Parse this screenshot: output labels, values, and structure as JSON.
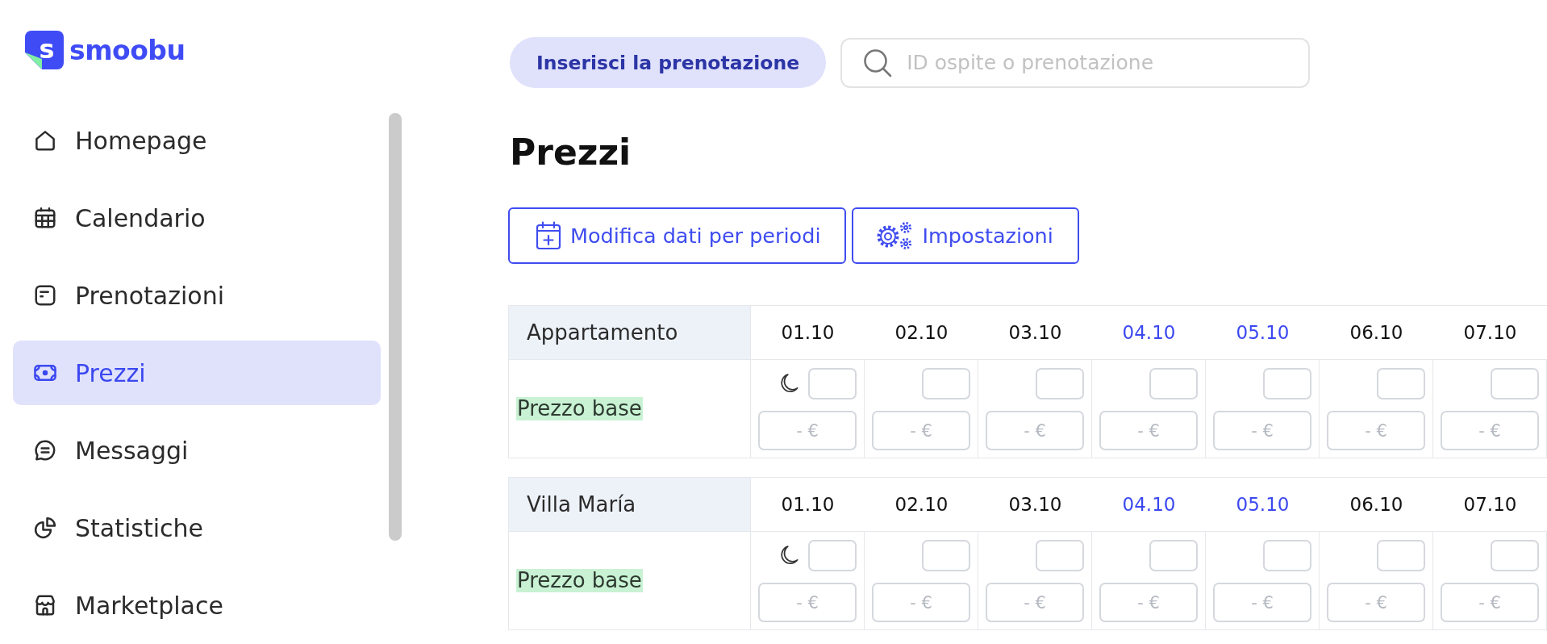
{
  "logo": {
    "mark": "s",
    "name": "smoobu"
  },
  "sidebar": {
    "items": [
      {
        "label": "Homepage",
        "selected": false
      },
      {
        "label": "Calendario",
        "selected": false
      },
      {
        "label": "Prenotazioni",
        "selected": false
      },
      {
        "label": "Prezzi",
        "selected": true
      },
      {
        "label": "Messaggi",
        "selected": false
      },
      {
        "label": "Statistiche",
        "selected": false
      },
      {
        "label": "Marketplace",
        "selected": false
      }
    ]
  },
  "topbar": {
    "add_button": "Inserisci la prenotazione",
    "search": {
      "placeholder": "ID ospite o prenotazione"
    }
  },
  "title": "Prezzi",
  "actions": [
    {
      "label": "Modifica dati per periodi"
    },
    {
      "label": "Impostazioni"
    }
  ],
  "properties": [
    {
      "name": "Appartamento",
      "days": [
        {
          "date": "01.10",
          "highlighted": false
        },
        {
          "date": "02.10",
          "highlighted": false
        },
        {
          "date": "03.10",
          "highlighted": false
        },
        {
          "date": "04.10",
          "highlighted": true
        },
        {
          "date": "05.10",
          "highlighted": true
        },
        {
          "date": "06.10",
          "highlighted": false
        },
        {
          "date": "07.10",
          "highlighted": false
        }
      ],
      "rows": [
        {
          "label": "Prezzo base",
          "cells": [
            {
              "marked": true,
              "placeholder": "- €"
            },
            {
              "marked": false,
              "placeholder": "- €"
            },
            {
              "marked": false,
              "placeholder": "- €"
            },
            {
              "marked": false,
              "placeholder": "- €"
            },
            {
              "marked": false,
              "placeholder": "- €"
            },
            {
              "marked": false,
              "placeholder": "- €"
            },
            {
              "marked": false,
              "placeholder": "- €"
            }
          ]
        }
      ]
    },
    {
      "name": "Villa María",
      "days": [
        {
          "date": "01.10",
          "highlighted": false
        },
        {
          "date": "02.10",
          "highlighted": false
        },
        {
          "date": "03.10",
          "highlighted": false
        },
        {
          "date": "04.10",
          "highlighted": true
        },
        {
          "date": "05.10",
          "highlighted": true
        },
        {
          "date": "06.10",
          "highlighted": false
        },
        {
          "date": "07.10",
          "highlighted": false
        }
      ],
      "rows": [
        {
          "label": "Prezzo base",
          "cells": [
            {
              "marked": true,
              "placeholder": "- €"
            },
            {
              "marked": false,
              "placeholder": "- €"
            },
            {
              "marked": false,
              "placeholder": "- €"
            },
            {
              "marked": false,
              "placeholder": "- €"
            },
            {
              "marked": false,
              "placeholder": "- €"
            },
            {
              "marked": false,
              "placeholder": "- €"
            },
            {
              "marked": false,
              "placeholder": "- €"
            }
          ]
        }
      ]
    }
  ]
}
